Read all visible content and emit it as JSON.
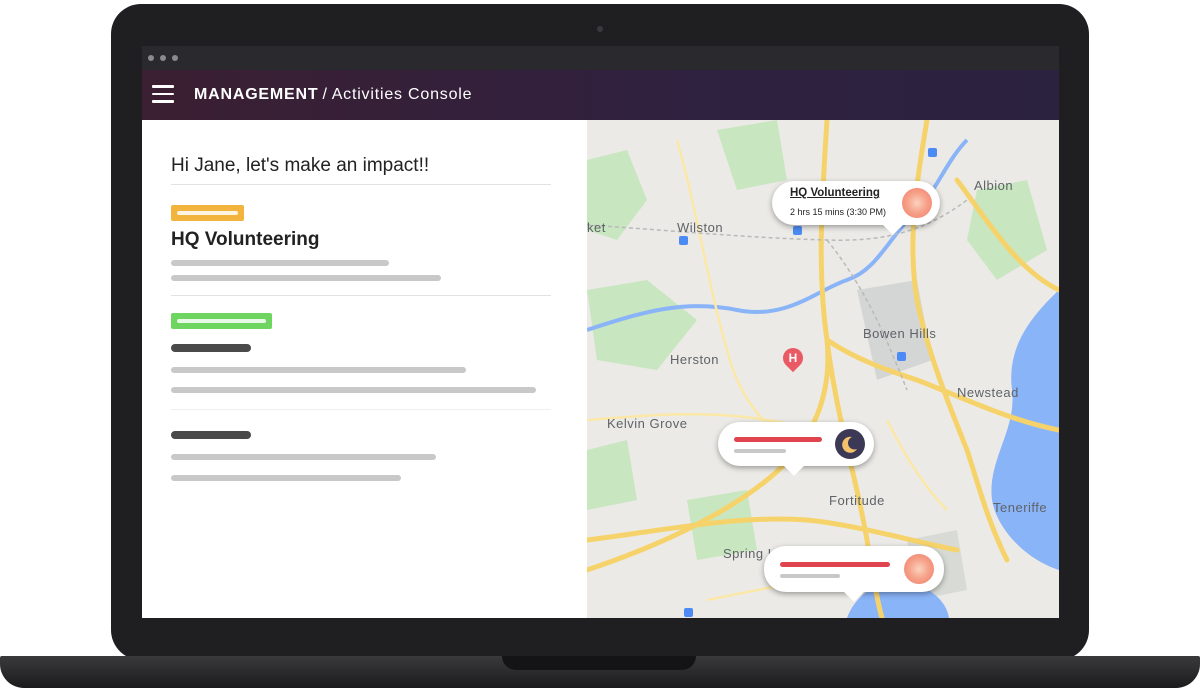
{
  "app": {
    "brand": "MANAGEMENT",
    "separator": "/",
    "section": "Activities Console"
  },
  "left_panel": {
    "greeting": "Hi Jane, let's make an impact!!",
    "cards": [
      {
        "tag_color": "#f2b43c",
        "title": "HQ Volunteering"
      },
      {
        "tag_color": "#6ed660",
        "title": ""
      },
      {
        "title": ""
      }
    ]
  },
  "map": {
    "places": {
      "albion": "Albion",
      "wilston": "Wilston",
      "market": "ket",
      "bowen_hills": "Bowen Hills",
      "herston": "Herston",
      "newstead": "Newstead",
      "kelvin_grove": "Kelvin Grove",
      "fortitude": "Fortitude",
      "teneriffe": "Teneriffe",
      "spring_hill": "Spring Hill"
    },
    "hq_callout": {
      "name": "HQ Volunteering",
      "time": "2 hrs 15 mins (3:30 PM)",
      "icon": "sun-icon"
    },
    "callout_2_icon": "moon-icon",
    "callout_3_icon": "sun-icon",
    "hospital_marker": "H"
  },
  "colors": {
    "appbar_start": "#3b1f32",
    "appbar_end": "#2b2240",
    "accent_yellow": "#f2b43c",
    "accent_green": "#6ed660",
    "accent_red": "#e0454f",
    "road_yellow": "#f6d36a",
    "water": "#8ab4f8",
    "park": "#c8e6c0"
  }
}
